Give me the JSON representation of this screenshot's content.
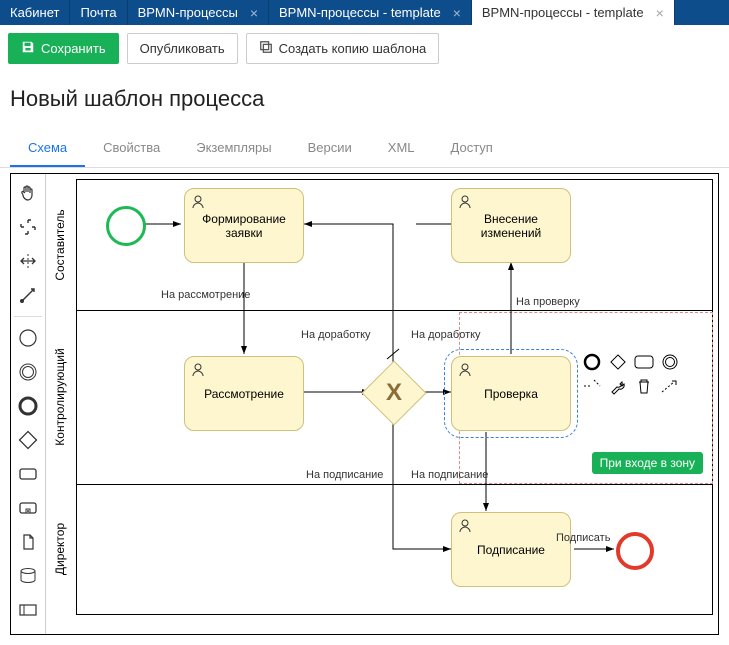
{
  "topTabs": {
    "items": [
      {
        "label": "Кабинет"
      },
      {
        "label": "Почта"
      },
      {
        "label": "BPMN-процессы",
        "closable": true
      },
      {
        "label": "BPMN-процессы - template",
        "closable": true
      },
      {
        "label": "BPMN-процессы - template",
        "closable": true,
        "active": true
      }
    ]
  },
  "toolbar": {
    "save": "Сохранить",
    "publish": "Опубликовать",
    "copyTemplate": "Создать копию шаблона"
  },
  "pageTitle": "Новый шаблон процесса",
  "viewTabs": {
    "items": [
      {
        "label": "Схема",
        "active": true
      },
      {
        "label": "Свойства"
      },
      {
        "label": "Экземпляры"
      },
      {
        "label": "Версии"
      },
      {
        "label": "XML"
      },
      {
        "label": "Доступ"
      }
    ]
  },
  "lanes": {
    "l1": "Составитель",
    "l2": "Контролирующий",
    "l3": "Директор"
  },
  "tasks": {
    "t1": "Формирование заявки",
    "t2": "Внесение изменений",
    "t3": "Рассмотрение",
    "t4": "Проверка",
    "t5": "Подписание"
  },
  "edges": {
    "e1": "На рассмотрение",
    "e2": "На доработку",
    "e3": "На доработку",
    "e4": "На проверку",
    "e5": "На подписание",
    "e6": "На подписание",
    "e7": "Подписать"
  },
  "badge": "При входе в зону",
  "paletteTools": {
    "hand": "hand-tool",
    "lasso": "lasso-tool",
    "space": "space-tool",
    "connect": "global-connect",
    "startEvent": "start-event",
    "intermediate": "intermediate-event",
    "endEvent": "end-event",
    "gateway": "exclusive-gateway",
    "task": "task",
    "subprocess": "subprocess",
    "dataObject": "data-object",
    "dataStore": "data-store",
    "pool": "participant"
  },
  "contextPad": {
    "items": [
      "start-event",
      "gateway",
      "intermediate",
      "task",
      "end-event",
      "connect",
      "wrench",
      "trash",
      "annotation"
    ]
  }
}
